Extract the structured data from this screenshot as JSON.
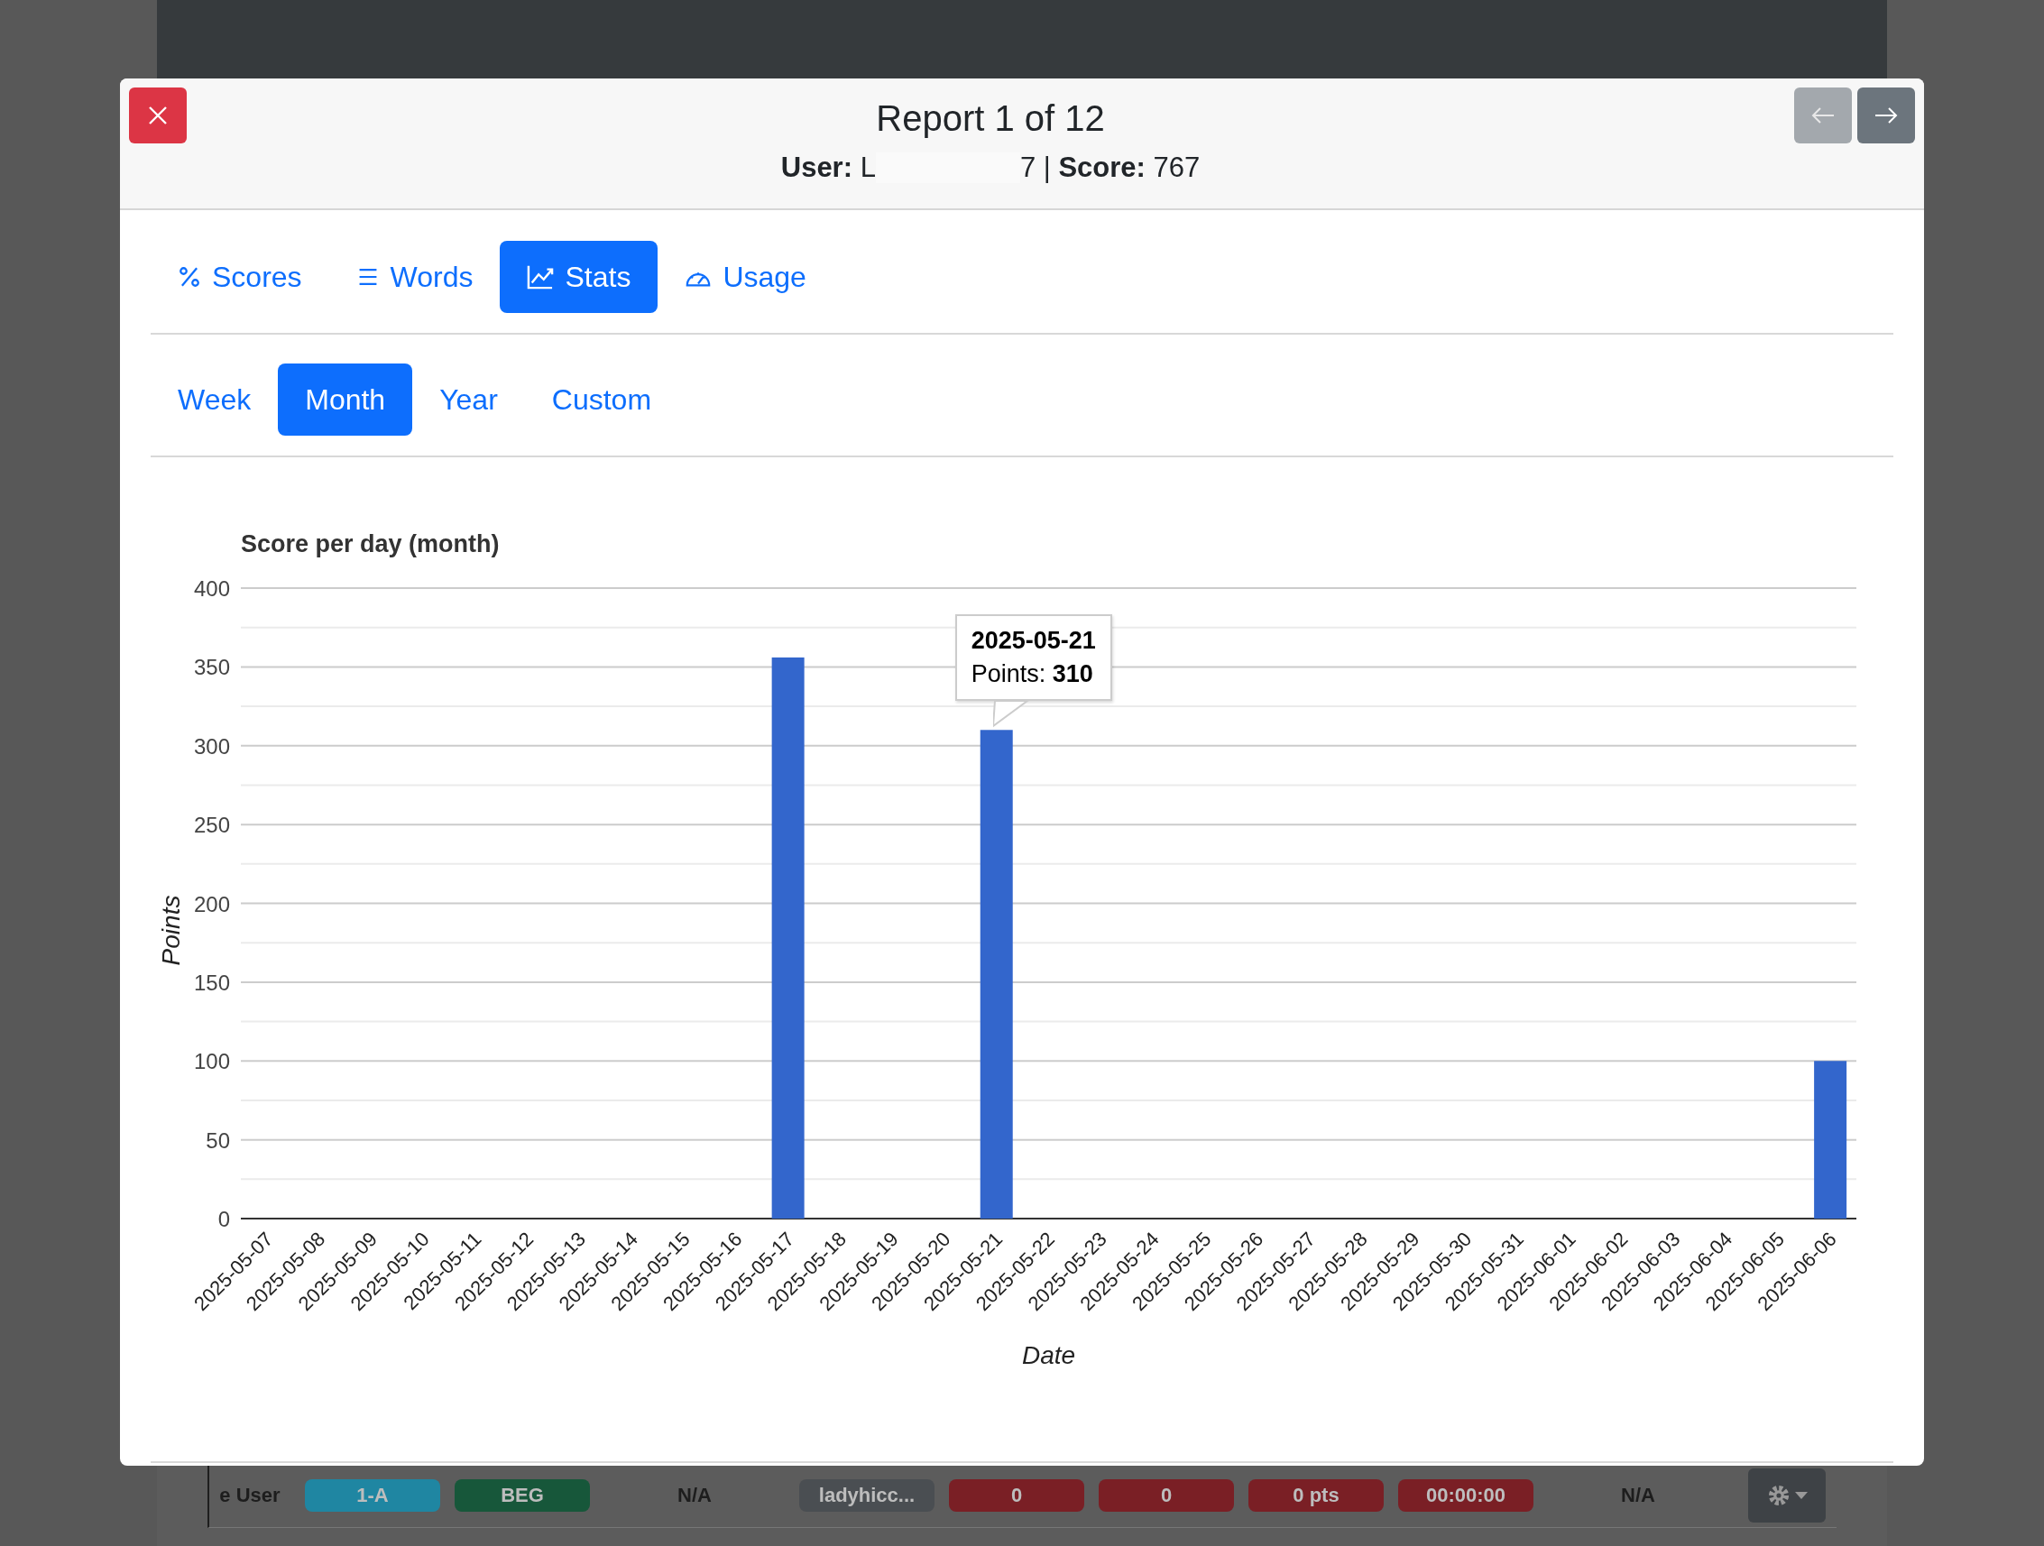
{
  "background_row": {
    "cells": [
      {
        "kind": "text",
        "text": "e User"
      },
      {
        "kind": "badge",
        "text": "1-A",
        "color": "#1f86a2"
      },
      {
        "kind": "badge",
        "text": "BEG",
        "color": "#17573a"
      },
      {
        "kind": "text",
        "text": "N/A"
      },
      {
        "kind": "badge",
        "text": "ladyhicc...",
        "color": "#4a4e52"
      },
      {
        "kind": "badge",
        "text": "0",
        "color": "#7a1f25"
      },
      {
        "kind": "badge",
        "text": "0",
        "color": "#7a1f25"
      },
      {
        "kind": "badge",
        "text": "0 pts",
        "color": "#7a1f25"
      },
      {
        "kind": "badge",
        "text": "00:00:00",
        "color": "#7a1f25"
      },
      {
        "kind": "text",
        "text": "N/A"
      }
    ]
  },
  "modal": {
    "title": "Report 1 of 12",
    "user_label": "User:",
    "user_start": "L",
    "user_end": "7",
    "separator": "|",
    "score_label": "Score:",
    "score": "767",
    "nav": [
      {
        "disabled": true
      },
      {
        "disabled": false
      }
    ]
  },
  "tabs": [
    {
      "label": "Scores",
      "selected": false
    },
    {
      "label": "Words",
      "selected": false
    },
    {
      "label": "Stats",
      "selected": true
    },
    {
      "label": "Usage",
      "selected": false
    }
  ],
  "periods": [
    {
      "label": "Week",
      "selected": false
    },
    {
      "label": "Month",
      "selected": true
    },
    {
      "label": "Year",
      "selected": false
    },
    {
      "label": "Custom",
      "selected": false
    }
  ],
  "chart": {
    "tooltip": {
      "date": "2025-05-21",
      "text": "Points: **310**"
    },
    "chart_data": {
      "type": "bar",
      "title": "Score per day (month)",
      "xlabel": "Date",
      "ylabel": "Points",
      "categories": [
        "2025-05-07",
        "2025-05-08",
        "2025-05-09",
        "2025-05-10",
        "2025-05-11",
        "2025-05-12",
        "2025-05-13",
        "2025-05-14",
        "2025-05-15",
        "2025-05-16",
        "2025-05-17",
        "2025-05-18",
        "2025-05-19",
        "2025-05-20",
        "2025-05-21",
        "2025-05-22",
        "2025-05-23",
        "2025-05-24",
        "2025-05-25",
        "2025-05-26",
        "2025-05-27",
        "2025-05-28",
        "2025-05-29",
        "2025-05-30",
        "2025-05-31",
        "2025-06-01",
        "2025-06-02",
        "2025-06-03",
        "2025-06-04",
        "2025-06-05",
        "2025-06-06"
      ],
      "grid": true,
      "series": [
        {
          "color": "#3366cc",
          "values": [
            0,
            0,
            0,
            0,
            0,
            0,
            0,
            0,
            0,
            0,
            356,
            0,
            0,
            0,
            310,
            0,
            0,
            0,
            0,
            0,
            0,
            0,
            0,
            0,
            0,
            0,
            0,
            0,
            0,
            0,
            100
          ]
        }
      ],
      "ylim": [
        0,
        400
      ],
      "yticks": [
        0,
        50,
        100,
        150,
        200,
        250,
        300,
        350,
        400
      ]
    }
  }
}
